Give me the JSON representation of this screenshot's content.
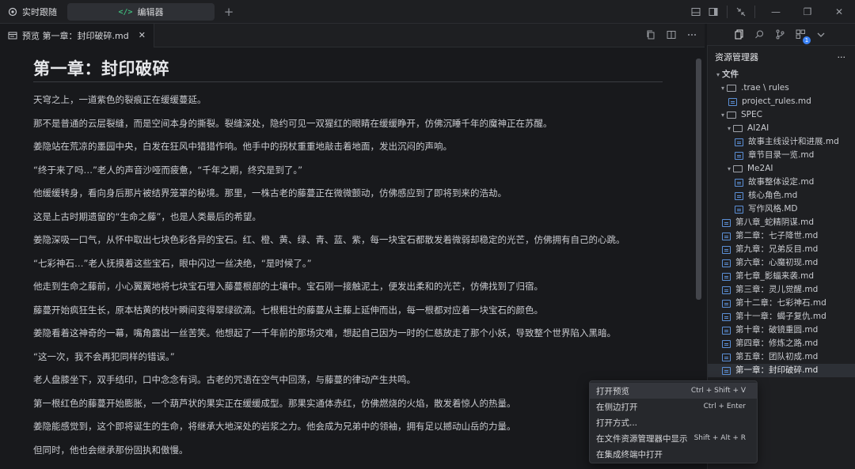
{
  "titlebar": {
    "live_follow": "实时跟随",
    "tab_label": "编辑器",
    "plus": "+",
    "window_minimize": "—",
    "window_restore": "❐",
    "window_close": "✕"
  },
  "editor": {
    "tab_title": "预览 第一章：封印破碎.md",
    "close": "✕",
    "heading": "第一章：封印破碎",
    "paragraphs": [
      "天穹之上，一道紫色的裂痕正在缓缓蔓延。",
      "那不是普通的云层裂缝，而是空间本身的撕裂。裂缝深处，隐约可见一双猩红的眼睛在缓缓睁开，仿佛沉睡千年的魔神正在苏醒。",
      "姜隐站在荒凉的墨园中央，白发在狂风中猎猎作响。他手中的拐杖重重地敲击着地面，发出沉闷的声响。",
      "“终于来了吗…”老人的声音沙哑而疲惫，“千年之期，终究是到了。”",
      "他缓缓转身，看向身后那片被结界笼罩的秘境。那里，一株古老的藤蔓正在微微颤动，仿佛感应到了即将到来的浩劫。",
      "这是上古时期遗留的“生命之藤”，也是人类最后的希望。",
      "姜隐深吸一口气，从怀中取出七块色彩各异的宝石。红、橙、黄、绿、青、蓝、紫，每一块宝石都散发着微弱却稳定的光芒，仿佛拥有自己的心跳。",
      "“七彩神石…”老人抚摸着这些宝石，眼中闪过一丝决绝，“是时候了。”",
      "他走到生命之藤前，小心翼翼地将七块宝石埋入藤蔓根部的土壤中。宝石刚一接触泥土，便发出柔和的光芒，仿佛找到了归宿。",
      "藤蔓开始疯狂生长，原本枯黄的枝叶瞬间变得翠绿欲滴。七根粗壮的藤蔓从主藤上延伸而出，每一根都对应着一块宝石的颜色。",
      "姜隐看着这神奇的一幕，嘴角露出一丝苦笑。他想起了一千年前的那场灾难，想起自己因为一时的仁慈放走了那个小妖，导致整个世界陷入黑暗。",
      "“这一次，我不会再犯同样的错误。”",
      "老人盘膝坐下，双手结印，口中念念有词。古老的咒语在空气中回荡，与藤蔓的律动产生共鸣。",
      "第一根红色的藤蔓开始膨胀，一个葫芦状的果实正在缓缓成型。那果实通体赤红，仿佛燃烧的火焰，散发着惊人的热量。",
      "姜隐能感觉到，这个即将诞生的生命，将继承大地深处的岩浆之力。他会成为兄弟中的领袖，拥有足以撼动山岳的力量。",
      "但同时，他也会继承那份固执和傲慢。"
    ]
  },
  "explorer": {
    "title": "资源管理器",
    "more": "···",
    "items": [
      {
        "label": "文件",
        "indent": 0,
        "type": "root"
      },
      {
        "label": ".trae \\ rules",
        "indent": 1,
        "type": "folder"
      },
      {
        "label": "project_rules.md",
        "indent": 2,
        "type": "file"
      },
      {
        "label": "SPEC",
        "indent": 1,
        "type": "folder"
      },
      {
        "label": "AI2AI",
        "indent": 2,
        "type": "folder"
      },
      {
        "label": "故事主线设计和进展.md",
        "indent": 3,
        "type": "file"
      },
      {
        "label": "章节目录一览.md",
        "indent": 3,
        "type": "file"
      },
      {
        "label": "Me2AI",
        "indent": 2,
        "type": "folder"
      },
      {
        "label": "故事整体设定.md",
        "indent": 3,
        "type": "file"
      },
      {
        "label": "核心角色.md",
        "indent": 3,
        "type": "file"
      },
      {
        "label": "写作风格.MD",
        "indent": 3,
        "type": "file"
      },
      {
        "label": "第八章_蛇精阴谋.md",
        "indent": 1,
        "type": "file"
      },
      {
        "label": "第二章：七子降世.md",
        "indent": 1,
        "type": "file"
      },
      {
        "label": "第九章：兄弟反目.md",
        "indent": 1,
        "type": "file"
      },
      {
        "label": "第六章：心魔初现.md",
        "indent": 1,
        "type": "file"
      },
      {
        "label": "第七章_影蝠来袭.md",
        "indent": 1,
        "type": "file"
      },
      {
        "label": "第三章：灵儿觉醒.md",
        "indent": 1,
        "type": "file"
      },
      {
        "label": "第十二章：七彩神石.md",
        "indent": 1,
        "type": "file"
      },
      {
        "label": "第十一章：蝎子复仇.md",
        "indent": 1,
        "type": "file"
      },
      {
        "label": "第十章：破镜重圆.md",
        "indent": 1,
        "type": "file"
      },
      {
        "label": "第四章：修炼之路.md",
        "indent": 1,
        "type": "file"
      },
      {
        "label": "第五章：团队初成.md",
        "indent": 1,
        "type": "file"
      },
      {
        "label": "第一章：封印破碎.md",
        "indent": 1,
        "type": "file",
        "selected": true
      }
    ],
    "badge_count": "1"
  },
  "context_menu": {
    "items": [
      {
        "label": "打开预览",
        "shortcut": "Ctrl + Shift + V"
      },
      {
        "label": "在侧边打开",
        "shortcut": "Ctrl + Enter"
      },
      {
        "label": "打开方式...",
        "shortcut": ""
      },
      {
        "label": "在文件资源管理器中显示",
        "shortcut": "Shift + Alt + R"
      },
      {
        "label": "在集成终端中打开",
        "shortcut": ""
      }
    ]
  }
}
